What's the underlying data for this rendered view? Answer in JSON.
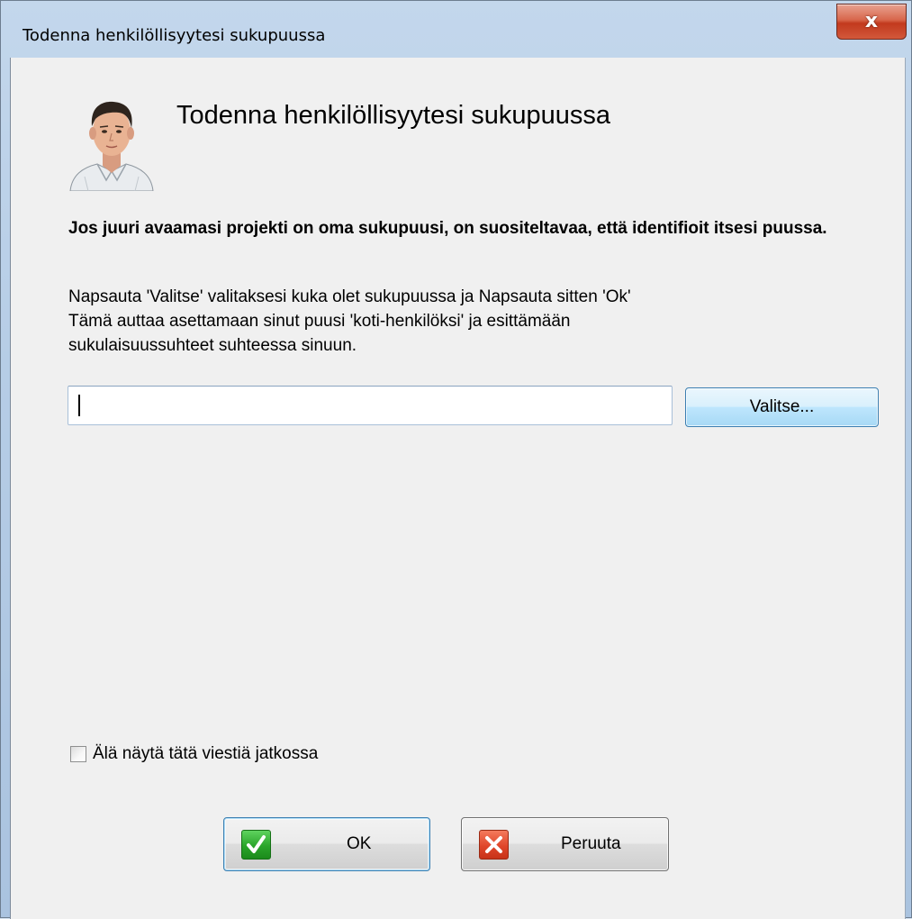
{
  "window": {
    "title": "Todenna henkilöllisyytesi sukupuussa",
    "close_label": "x"
  },
  "dialog": {
    "heading": "Todenna henkilöllisyytesi sukupuussa",
    "avatar_icon": "person-avatar-icon",
    "intro_bold": "Jos juuri avaamasi projekti on oma sukupuusi, on suositeltavaa, että identifioit itsesi puussa.",
    "explain_lines": [
      "Napsauta 'Valitse' valitaksesi kuka olet sukupuussa ja Napsauta sitten 'Ok'",
      "Tämä auttaa asettamaan sinut puusi 'koti-henkilöksi' ja esittämään",
      "sukulaisuussuhteet suhteessa sinuun."
    ],
    "person_field_value": "",
    "choose_button": "Valitse...",
    "dont_show_checkbox": {
      "label": "Älä näytä tätä viestiä jatkossa",
      "checked": false
    },
    "ok_button": "OK",
    "cancel_button": "Peruuta"
  },
  "colors": {
    "accent_border": "#3c7fb1",
    "ok_icon": "#2aa52a",
    "cancel_icon": "#e0462a",
    "close_button": "#c2391d"
  }
}
